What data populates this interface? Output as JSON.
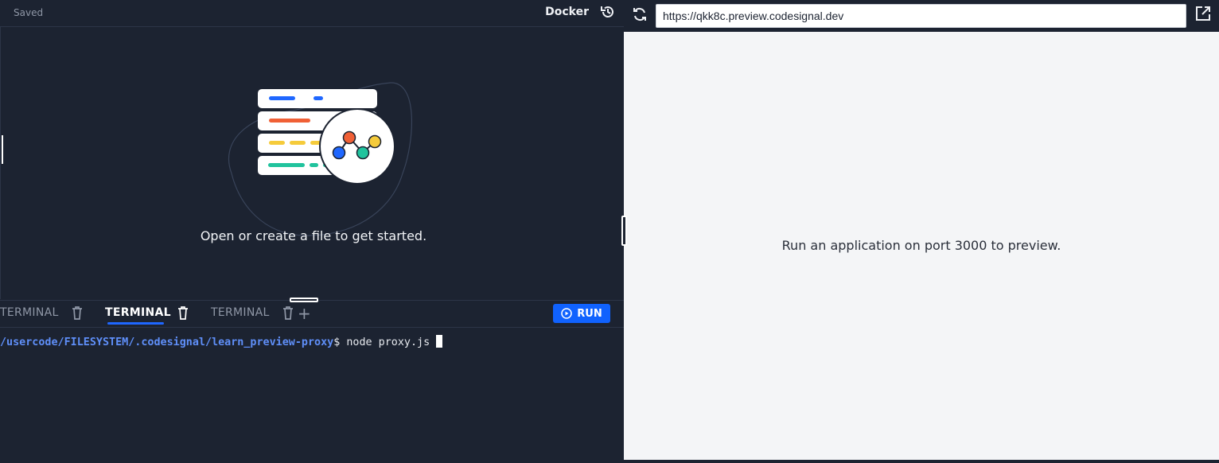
{
  "editor": {
    "status": "Saved",
    "environment": "Docker",
    "empty_message": "Open or create a file to get started."
  },
  "terminal": {
    "tabs": [
      {
        "label": "TERMINAL",
        "active": false
      },
      {
        "label": "TERMINAL",
        "active": true
      },
      {
        "label": "TERMINAL",
        "active": false
      }
    ],
    "run_label": "RUN",
    "prompt_path": "/usercode/FILESYSTEM/.codesignal/learn_preview-proxy",
    "prompt_symbol": "$",
    "command": "node proxy.js"
  },
  "preview": {
    "url": "https://qkk8c.preview.codesignal.dev",
    "message": "Run an application on port 3000 to preview."
  },
  "colors": {
    "accent": "#1062fe",
    "path": "#5f8ff9",
    "dark_bg": "#1c2331",
    "light_bg": "#f4f5f7"
  },
  "icons": [
    "history-icon",
    "trash-icon",
    "plus-icon",
    "play-icon",
    "refresh-icon",
    "external-link-icon"
  ]
}
